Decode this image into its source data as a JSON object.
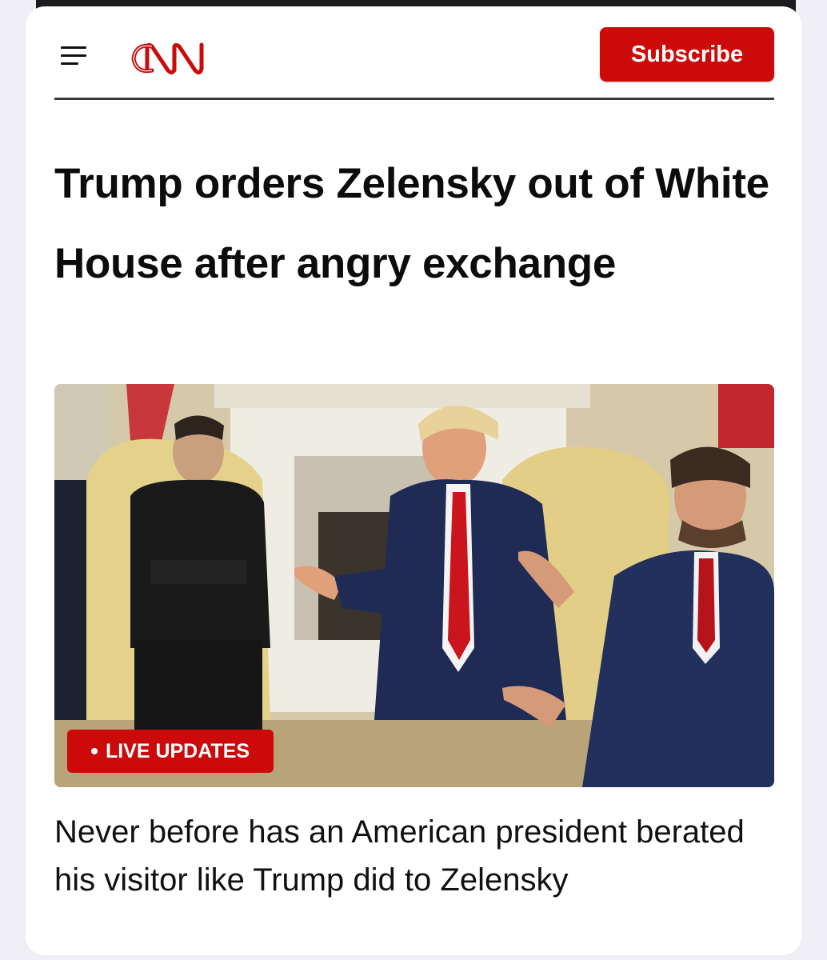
{
  "header": {
    "menu_icon": "hamburger-menu-icon",
    "logo_text": "CNN",
    "subscribe_label": "Subscribe"
  },
  "article": {
    "headline": "Trump orders Zelensky out of White House after angry exchange",
    "badge_label": "LIVE UPDATES",
    "subheadline": "Never before has an American president berated his visitor like Trump did to Zelensky"
  },
  "colors": {
    "brand_red": "#cc0a0a",
    "text": "#0c0c0c",
    "background": "#ffffff"
  }
}
